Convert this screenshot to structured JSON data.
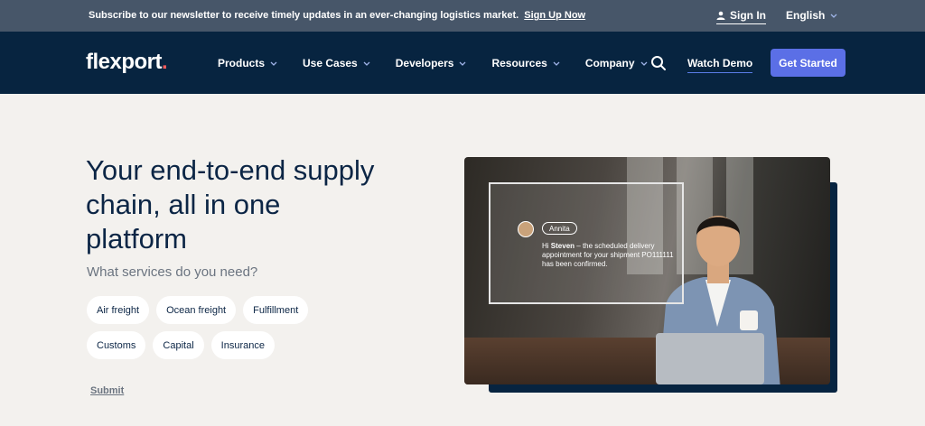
{
  "topbar": {
    "message": "Subscribe to our newsletter to receive timely updates in an ever-changing logistics market.",
    "signup_link": "Sign Up Now",
    "sign_in": "Sign In",
    "language": "English"
  },
  "nav": {
    "logo_text": "flexport",
    "logo_dot": ".",
    "menu": [
      "Products",
      "Use Cases",
      "Developers",
      "Resources",
      "Company"
    ],
    "watch_demo": "Watch Demo",
    "get_started": "Get Started"
  },
  "hero": {
    "title": "Your end-to-end supply chain, all in one platform",
    "subtitle": "What services do you need?",
    "services": [
      "Air freight",
      "Ocean freight",
      "Fulfillment",
      "Customs",
      "Capital",
      "Insurance"
    ],
    "submit": "Submit"
  },
  "chat": {
    "name": "Annita",
    "greeting": "Hi",
    "recipient": "Steven",
    "message": "– the scheduled delivery appointment for your shipment PO111111 has been confirmed."
  },
  "colors": {
    "topbar_bg": "#475669",
    "nav_bg": "#072440",
    "accent": "#5b6fe6",
    "page_bg": "#f3f1ee",
    "logo_dot": "#ff5b5b"
  }
}
